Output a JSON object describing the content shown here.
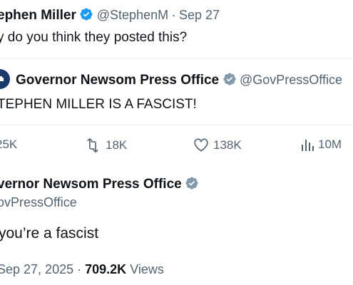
{
  "tweet": {
    "author_name": "ephen Miller",
    "author_handle": "@StephenM",
    "separator": "·",
    "date": "Sep 27",
    "text": "y do you think they posted this?"
  },
  "quoted_tweet": {
    "author_name": "Governor Newsom Press Office",
    "author_handle": "@GovPressOffice",
    "text": "TEPHEN MILLER IS A FASCIST!"
  },
  "actions": {
    "replies": "25K",
    "reposts": "18K",
    "likes": "138K",
    "views": "10M"
  },
  "reply": {
    "author_name": "vernor Newsom Press Office",
    "author_handle": "ovPressOffice",
    "text": "you’re a fascist",
    "timestamp": "Sep 27, 2025",
    "separator": "·",
    "view_count": "709.2K",
    "view_label": "Views"
  },
  "colors": {
    "verified_blue": "#1d9bf0",
    "verified_gray": "#829aab",
    "text_primary": "#0f1419",
    "text_secondary": "#536471",
    "avatar_bg": "#1a3a6b"
  },
  "icons": [
    "verified-blue-icon",
    "verified-gray-icon",
    "reply-icon",
    "repost-icon",
    "like-icon",
    "views-icon"
  ]
}
